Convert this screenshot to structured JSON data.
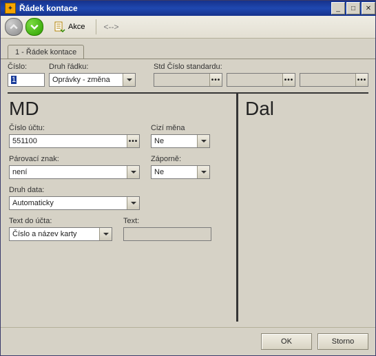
{
  "window": {
    "title": "Řádek kontace"
  },
  "toolbar": {
    "action_label": "Akce",
    "nav_label": "<-->"
  },
  "tab": {
    "label": "1 -  Řádek kontace"
  },
  "top": {
    "cislo_label": "Číslo:",
    "cislo_value": "1",
    "druh_label": "Druh řádku:",
    "druh_value": "Oprávky - změna",
    "std_label": "Std Číslo standardu:",
    "std1": "",
    "std2": "",
    "std3": ""
  },
  "md": {
    "title": "MD",
    "ucet_label": "Číslo účtu:",
    "ucet_value": "551100",
    "mena_label": "Cizí měna",
    "mena_value": "Ne",
    "parz_label": "Párovací znak:",
    "parz_value": "není",
    "zap_label": "Záporně:",
    "zap_value": "Ne",
    "druhd_label": "Druh data:",
    "druhd_value": "Automaticky",
    "texta_label": "Text do účta:",
    "texta_value": "Číslo a název karty",
    "textb_label": "Text:",
    "textb_value": ""
  },
  "dal": {
    "title": "Dal"
  },
  "buttons": {
    "ok": "OK",
    "cancel": "Storno"
  },
  "winctrl": {
    "min": "_",
    "max": "□",
    "close": "✕"
  }
}
